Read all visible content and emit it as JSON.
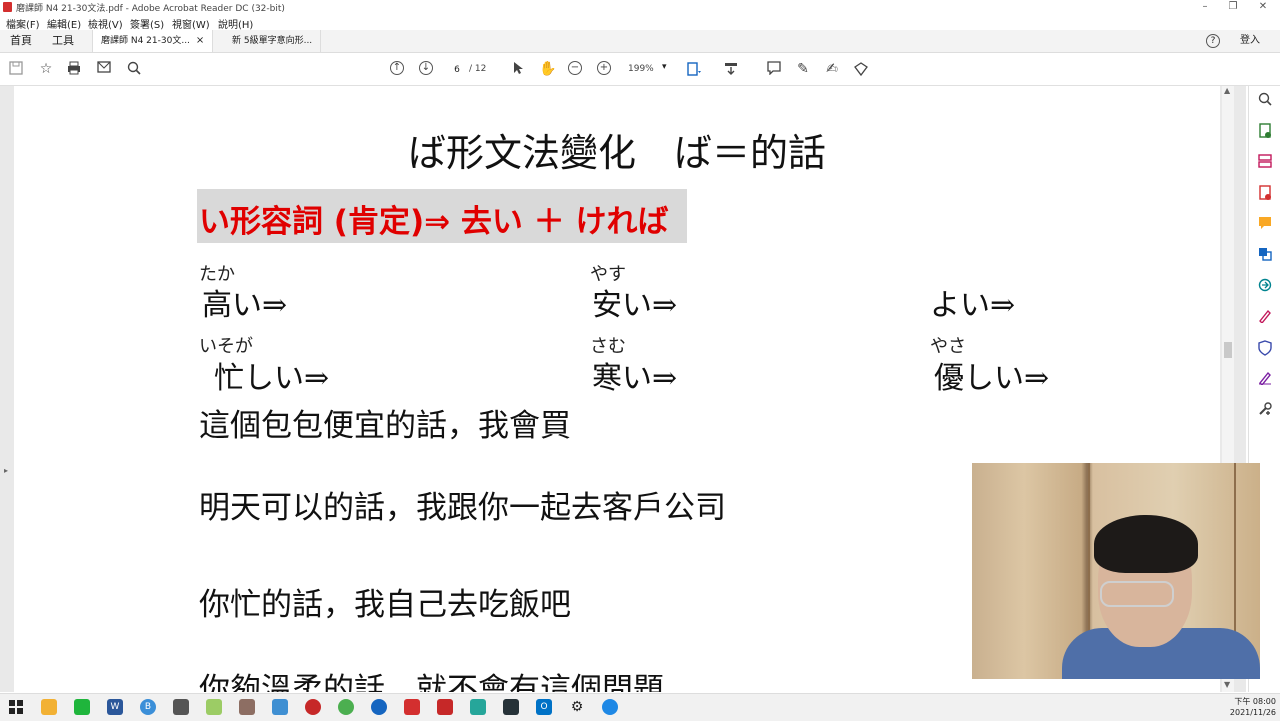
{
  "window": {
    "title": "磨課師 N4 21-30文法.pdf - Adobe Acrobat Reader DC (32-bit)",
    "minimize": "–",
    "restore": "❐",
    "close": "✕"
  },
  "menu": [
    "檔案(F)",
    "編輯(E)",
    "檢視(V)",
    "簽署(S)",
    "視窗(W)",
    "說明(H)"
  ],
  "tabs": {
    "home": "首頁",
    "tools": "工具",
    "doc1": "磨課師 N4 21-30文...",
    "doc1_close": "×",
    "doc2": "新 5級單字意向形...",
    "help": "?",
    "signin": "登入"
  },
  "toolbar": {
    "current_page": "6",
    "total_pages": "/ 12",
    "zoom": "199%",
    "zoom_caret": "▾"
  },
  "document": {
    "heading": "ば形文法變化　ば＝的話",
    "rule": "い形容詞 (肯定)⇒ 去い ＋ ければ",
    "examples": [
      {
        "ruby": "たか",
        "word": "高い⇒"
      },
      {
        "ruby": "やす",
        "word": "安い⇒"
      },
      {
        "ruby": "",
        "word": "よい⇒"
      },
      {
        "ruby": "いそが",
        "word": "忙しい⇒"
      },
      {
        "ruby": "さむ",
        "word": "寒い⇒"
      },
      {
        "ruby": "やさ",
        "word": "優しい⇒"
      }
    ],
    "sentences": [
      "這個包包便宜的話，我會買",
      "明天可以的話，我跟你一起去客戶公司",
      "你忙的話，我自己去吃飯吧",
      "你夠溫柔的話，就不會有這個問題"
    ]
  },
  "taskbar": {
    "time": "下午 08:00",
    "date": "2021/11/26"
  },
  "colors": {
    "rule_text": "#e00000",
    "rule_box": "#d9d9d9",
    "acrobat_red": "#d32f2f"
  }
}
